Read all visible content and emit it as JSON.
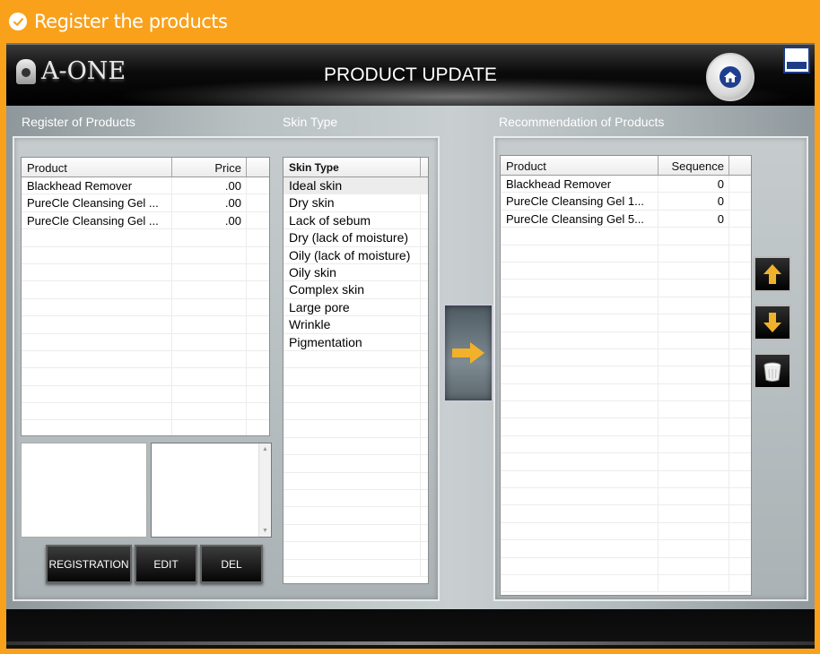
{
  "caption": {
    "text": "Register the products",
    "icon": "check-circle-icon"
  },
  "header": {
    "logo_text": "A-ONE",
    "title": "PRODUCT UPDATE",
    "home_icon": "home-icon",
    "minimize_icon": "minimize-icon"
  },
  "register": {
    "label": "Register of Products",
    "columns": {
      "product": "Product",
      "price": "Price"
    },
    "rows": [
      {
        "product": "Blackhead Remover",
        "price": ".00"
      },
      {
        "product": "PureCle Cleansing Gel ...",
        "price": ".00"
      },
      {
        "product": "PureCle Cleansing Gel ...",
        "price": ".00"
      }
    ],
    "buttons": {
      "registration": "REGISTRATION",
      "edit": "EDIT",
      "del": "DEL"
    }
  },
  "skin": {
    "label": "Skin Type",
    "column": "Skin Type",
    "selected_index": 0,
    "items": [
      "Ideal skin",
      "Dry skin",
      "Lack of sebum",
      "Dry (lack of moisture)",
      "Oily (lack of moisture)",
      "Oily skin",
      "Complex skin",
      "Large pore",
      "Wrinkle",
      "Pigmentation"
    ]
  },
  "recommend": {
    "label": "Recommendation of Products",
    "columns": {
      "product": "Product",
      "sequence": "Sequence"
    },
    "rows": [
      {
        "product": "Blackhead Remover",
        "sequence": "0"
      },
      {
        "product": "PureCle Cleansing Gel 1...",
        "sequence": "0"
      },
      {
        "product": "PureCle Cleansing Gel 5...",
        "sequence": "0"
      }
    ]
  },
  "colors": {
    "accent": "#f9a11b",
    "arrow": "#f2b12a"
  }
}
